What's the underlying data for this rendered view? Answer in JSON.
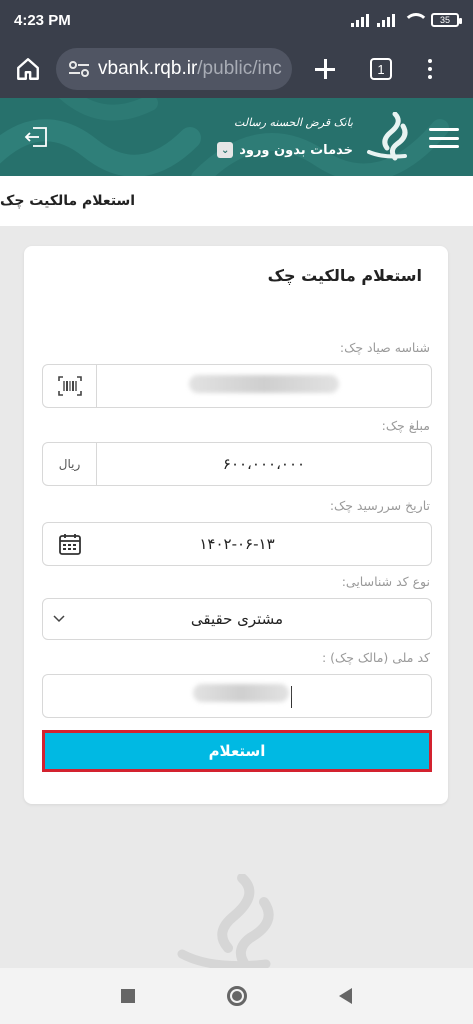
{
  "status_bar": {
    "time": "4:23 PM",
    "battery": "35"
  },
  "browser": {
    "url_host": "vbank.rqb.ir",
    "url_path": "/public/inc",
    "tab_count": "1"
  },
  "app_header": {
    "bank_name": "بانک قرض الحسنه رسالت",
    "services_label": "خدمات بدون ورود"
  },
  "page": {
    "title": "استعلام مالکیت چک"
  },
  "form": {
    "title": "استعلام مالکیت چک",
    "sayad_label": "شناسه صیاد چک:",
    "amount_label": "مبلغ چک:",
    "amount_value": "۶۰۰،۰۰۰،۰۰۰",
    "currency": "ریال",
    "due_date_label": "تاریخ سررسید چک:",
    "due_date_value": "۱۴۰۲-۰۶-۱۳",
    "id_type_label": "نوع کد شناسایی:",
    "id_type_value": "مشتری حقیقی",
    "national_code_label": "کد ملی (مالک چک) :",
    "submit_label": "استعلام"
  },
  "colors": {
    "header": "#27716c",
    "button": "#00b9e3",
    "button_border": "#d3222f"
  }
}
